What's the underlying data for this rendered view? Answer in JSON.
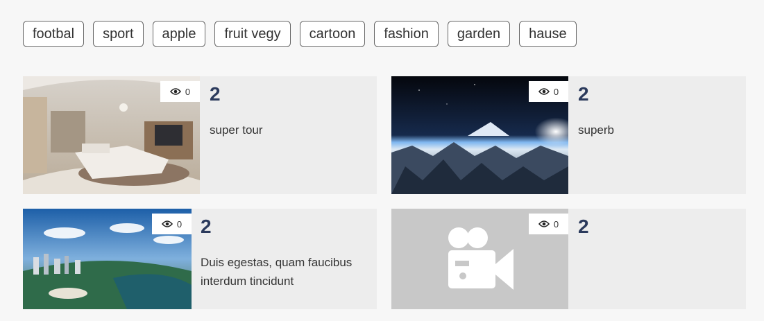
{
  "tags": [
    "footbal",
    "sport",
    "apple",
    "fruit vegy",
    "cartoon",
    "fashion",
    "garden",
    "hause"
  ],
  "cards": [
    {
      "views": "0",
      "count": "2",
      "description": "super tour",
      "image": "bedroom-panorama"
    },
    {
      "views": "0",
      "count": "2",
      "description": "superb",
      "image": "mountain-space-panorama"
    },
    {
      "views": "0",
      "count": "2",
      "description": "Duis egestas, quam faucibus interdum tincidunt",
      "image": "city-aerial-panorama"
    },
    {
      "views": "0",
      "count": "2",
      "description": "",
      "image": "video-camera-placeholder-icon"
    }
  ],
  "colors": {
    "accent_text": "#2b3a5c",
    "card_bg": "#ededed",
    "placeholder_bg": "#c8c8c8"
  }
}
